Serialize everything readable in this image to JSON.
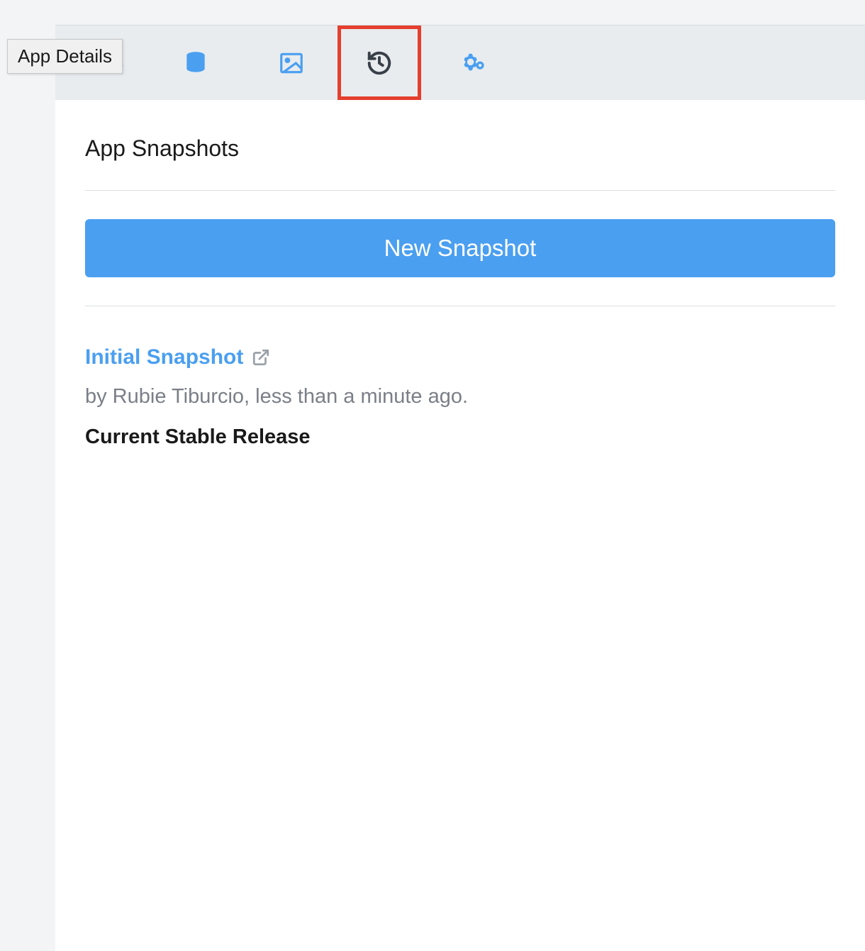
{
  "tooltip": {
    "text": "App Details"
  },
  "tabs": {
    "database_icon": "database-icon",
    "image_icon": "image-icon",
    "history_icon": "history-icon",
    "settings_icon": "settings-icon"
  },
  "page": {
    "heading": "App Snapshots",
    "new_snapshot_button": "New Snapshot"
  },
  "snapshot": {
    "title": "Initial Snapshot",
    "meta": "by Rubie Tiburcio, less than a minute ago.",
    "status": "Current Stable Release"
  }
}
